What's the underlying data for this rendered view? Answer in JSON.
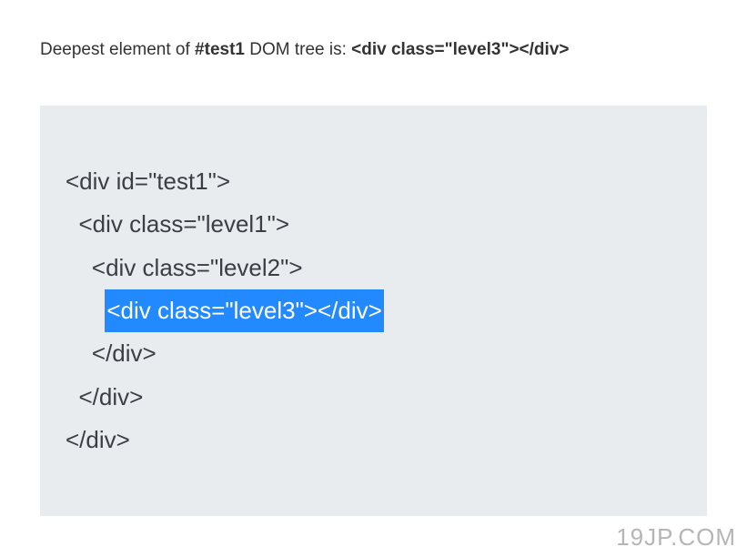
{
  "heading": {
    "prefix": "Deepest element of ",
    "bold1": "#test1",
    "mid": " DOM tree is: ",
    "bold2": "<div class=\"level3\"></div>"
  },
  "code": {
    "line1": "<div id=\"test1\">",
    "line2": "  <div class=\"level1\">",
    "line3": "    <div class=\"level2\">",
    "line4_indent": "      ",
    "line4_highlight": "<div class=\"level3\"></div>",
    "line5": "    </div>",
    "line6": "  </div>",
    "line7": "</div>"
  },
  "watermark": "19JP.COM"
}
